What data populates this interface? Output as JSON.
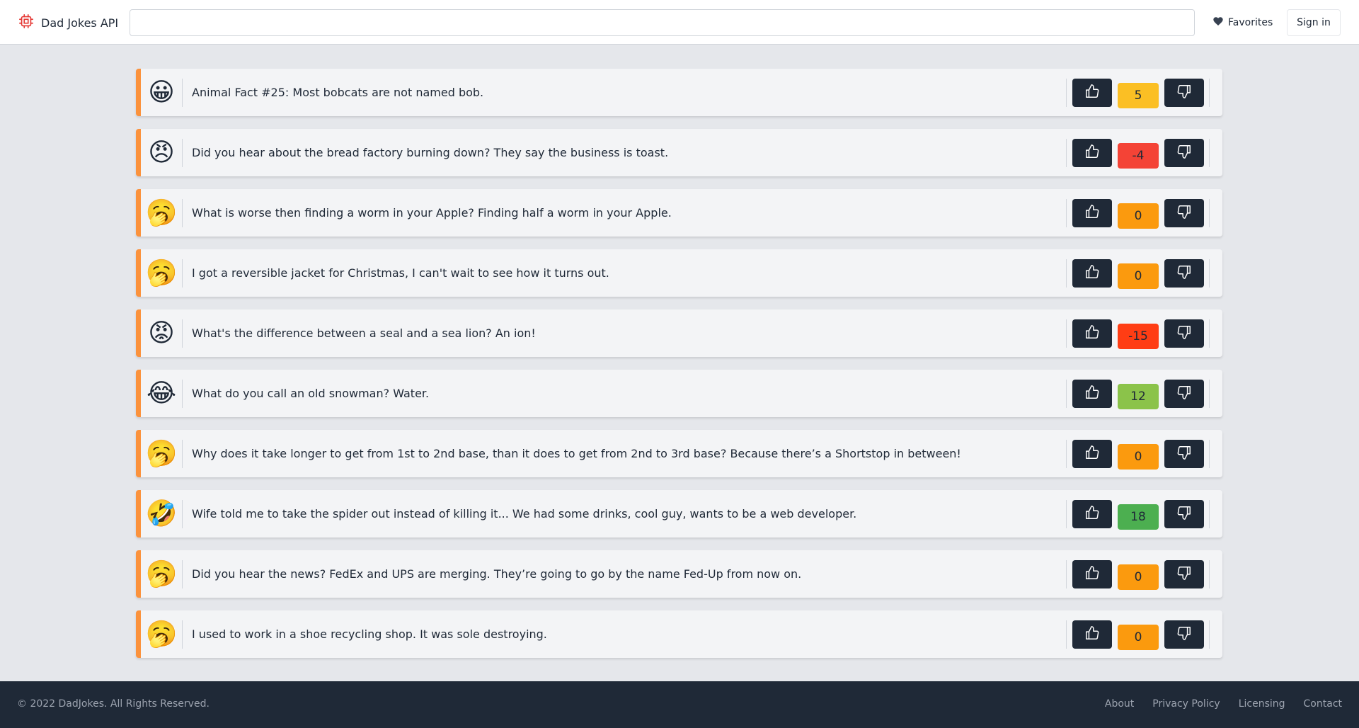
{
  "header": {
    "brand": "Dad Jokes API",
    "brand_icon": "cpu-chip-icon",
    "search_value": "",
    "favorites_label": "Favorites",
    "signin_label": "Sign in"
  },
  "colors": {
    "accent": "#fb923c",
    "dark": "#1f2937",
    "score_yellow": "#fbbf24",
    "score_orange": "#fb9a0e",
    "score_red": "#f44336",
    "score_deep_red": "#ff3d14",
    "score_light_green": "#8bc34a",
    "score_green": "#4caf50"
  },
  "jokes": [
    {
      "emoji": "😀",
      "text": "Animal Fact #25: Most bobcats are not named bob.",
      "score": "5",
      "color": "#fbbf24"
    },
    {
      "emoji": "😠",
      "text": "Did you hear about the bread factory burning down? They say the business is toast.",
      "score": "-4",
      "color": "#f44336"
    },
    {
      "emoji": "🥱",
      "text": "What is worse then finding a worm in your Apple? Finding half a worm in your Apple.",
      "score": "0",
      "color": "#fb9a0e"
    },
    {
      "emoji": "🥱",
      "text": "I got a reversible jacket for Christmas, I can't wait to see how it turns out.",
      "score": "0",
      "color": "#fb9a0e"
    },
    {
      "emoji": "😡",
      "text": "What's the difference between a seal and a sea lion? An ion!",
      "score": "-15",
      "color": "#ff3d14"
    },
    {
      "emoji": "😂",
      "text": "What do you call an old snowman? Water.",
      "score": "12",
      "color": "#8bc34a"
    },
    {
      "emoji": "🥱",
      "text": "Why does it take longer to get from 1st to 2nd base, than it does to get from 2nd to 3rd base? Because there’s a Shortstop in between!",
      "score": "0",
      "color": "#fb9a0e"
    },
    {
      "emoji": "🤣",
      "text": "Wife told me to take the spider out instead of killing it... We had some drinks, cool guy, wants to be a web developer.",
      "score": "18",
      "color": "#4caf50"
    },
    {
      "emoji": "🥱",
      "text": "Did you hear the news? FedEx and UPS are merging. They’re going to go by the name Fed-Up from now on.",
      "score": "0",
      "color": "#fb9a0e"
    },
    {
      "emoji": "🥱",
      "text": "I used to work in a shoe recycling shop. It was sole destroying.",
      "score": "0",
      "color": "#fb9a0e"
    }
  ],
  "footer": {
    "copyright": "© 2022 DadJokes. All Rights Reserved.",
    "links": [
      "About",
      "Privacy Policy",
      "Licensing",
      "Contact"
    ]
  }
}
